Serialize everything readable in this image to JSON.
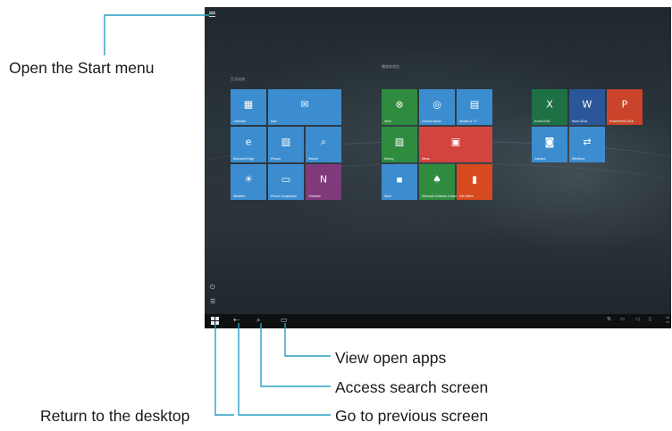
{
  "callouts": {
    "start_menu": "Open the Start menu",
    "view_apps": "View open apps",
    "search": "Access search screen",
    "desktop": "Return to the desktop",
    "previous": "Go to previous screen"
  },
  "leader_color": "#2a9fc4",
  "start_screen": {
    "tiles": [
      {
        "label": "Calendar",
        "icon": "calendar-icon",
        "glyph": "▦",
        "color": "#3c8dcf"
      },
      {
        "label": "Mail",
        "icon": "mail-icon",
        "glyph": "✉",
        "color": "#3c8dcf"
      },
      {
        "label": "Microsoft Edge",
        "icon": "edge-icon",
        "glyph": "e",
        "color": "#3c8dcf"
      },
      {
        "label": "Photos",
        "icon": "photos-icon",
        "glyph": "▧",
        "color": "#3c8dcf"
      },
      {
        "label": "Search",
        "icon": "search-icon",
        "glyph": "⌕",
        "color": "#3c8dcf"
      },
      {
        "label": "Weather",
        "icon": "weather-icon",
        "glyph": "☀",
        "color": "#3c8dcf"
      },
      {
        "label": "Phone Companion",
        "icon": "phone-companion-icon",
        "glyph": "▭",
        "color": "#3c8dcf"
      },
      {
        "label": "OneNote",
        "icon": "onenote-icon",
        "glyph": "N",
        "color": "#80397b"
      },
      {
        "label": "Xbox",
        "icon": "xbox-icon",
        "glyph": "⊗",
        "color": "#2f8c3f"
      },
      {
        "label": "Groove Music",
        "icon": "groove-music-icon",
        "glyph": "◎",
        "color": "#3c8dcf"
      },
      {
        "label": "Movies & TV",
        "icon": "movies-tv-icon",
        "glyph": "▤",
        "color": "#3c8dcf"
      },
      {
        "label": "Money",
        "icon": "money-icon",
        "glyph": "▨",
        "color": "#2f8c3f"
      },
      {
        "label": "News",
        "icon": "news-icon",
        "glyph": "▣",
        "color": "#d2453e"
      },
      {
        "label": "Store",
        "icon": "store-icon",
        "glyph": "▪",
        "color": "#3c8dcf"
      },
      {
        "label": "Microsoft Solitaire Collection",
        "icon": "solitaire-icon",
        "glyph": "♠",
        "color": "#2f8c3f"
      },
      {
        "label": "Get Office",
        "icon": "office-icon",
        "glyph": "▮",
        "color": "#d84a20"
      },
      {
        "label": "Excel 2016",
        "icon": "excel-icon",
        "glyph": "X",
        "color": "#1e7145"
      },
      {
        "label": "Word 2016",
        "icon": "word-icon",
        "glyph": "W",
        "color": "#2b579a"
      },
      {
        "label": "PowerPoint 2016",
        "icon": "powerpoint-icon",
        "glyph": "P",
        "color": "#c9442b"
      },
      {
        "label": "Camera",
        "icon": "camera-icon",
        "glyph": "◙",
        "color": "#3c8dcf"
      },
      {
        "label": "WinStore",
        "icon": "sync-icon",
        "glyph": "⇄",
        "color": "#3c8dcf"
      }
    ]
  },
  "taskbar": {
    "start": "start-icon",
    "back": "back-arrow-icon",
    "search": "search-icon",
    "task_view": "task-view-icon"
  }
}
